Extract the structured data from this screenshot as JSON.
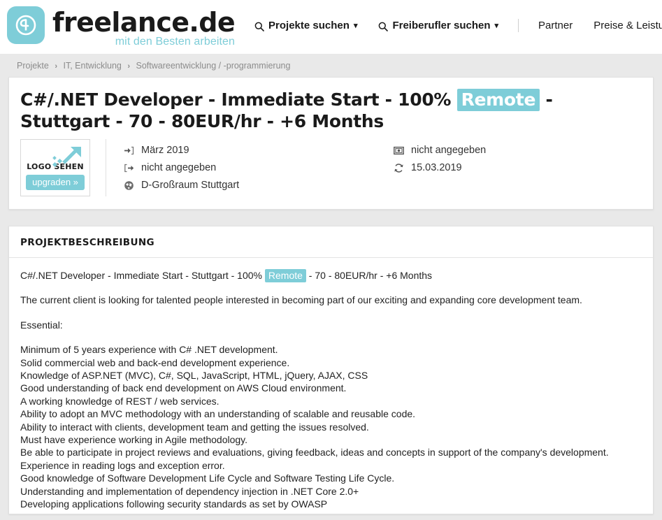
{
  "brand": {
    "name": "freelance.de",
    "tagline": "mit den Besten arbeiten",
    "logo_color": "#7ecdd8"
  },
  "nav": {
    "items": [
      {
        "label": "Projekte suchen",
        "icon": "search-icon",
        "caret": "⌄",
        "bold": true
      },
      {
        "label": "Freiberufler suchen",
        "icon": "search-icon",
        "caret": "⌄",
        "bold": true
      },
      {
        "label": "Partner",
        "icon": "",
        "caret": "",
        "bold": false
      },
      {
        "label": "Preise & Leistungen",
        "icon": "",
        "caret": "⌄",
        "bold": false
      }
    ]
  },
  "breadcrumb": {
    "separator": "›",
    "items": [
      "Projekte",
      "IT, Entwicklung",
      "Softwareentwicklung / -programmierung"
    ]
  },
  "project": {
    "title_part1": "C#/.NET Developer - Immediate Start - 100% ",
    "title_highlight": "Remote",
    "title_part2": " - Stuttgart - 70 - 80EUR/hr - +6 Months",
    "highlight_color": "#7ecdd8"
  },
  "logo_box": {
    "label": "LOGO SEHEN",
    "badge": "upgraden »",
    "badge_color": "#7ecdd8"
  },
  "meta": {
    "left": [
      {
        "icon": "arrow-into-bracket-icon",
        "value": "März 2019"
      },
      {
        "icon": "arrow-out-of-bracket-icon",
        "value": "nicht angegeben"
      },
      {
        "icon": "globe-icon",
        "value": "D-Großraum Stuttgart"
      }
    ],
    "right": [
      {
        "icon": "banknote-icon",
        "value": "nicht angegeben"
      },
      {
        "icon": "refresh-icon",
        "value": "15.03.2019"
      }
    ]
  },
  "description": {
    "heading": "PROJEKTBESCHREIBUNG",
    "headline_part1": "C#/.NET Developer - Immediate Start - Stuttgart - 100% ",
    "headline_highlight": "Remote",
    "headline_part2": " - 70 - 80EUR/hr - +6 Months",
    "intro": "The current client is looking for talented people interested in becoming part of our exciting and expanding core development team.",
    "section_label": "Essential:",
    "requirements": "Minimum of 5 years experience with C# .NET development.\nSolid commercial web and back-end development experience.\nKnowledge of ASP.NET (MVC), C#, SQL, JavaScript, HTML, jQuery, AJAX, CSS\nGood understanding of back end development on AWS Cloud environment.\nA working knowledge of REST / web services.\nAbility to adopt an MVC methodology with an understanding of scalable and reusable code.\nAbility to interact with clients, development team and getting the issues resolved.\nMust have experience working in Agile methodology.\nBe able to participate in project reviews and evaluations, giving feedback, ideas and concepts in support of the company's development.\nExperience in reading logs and exception error.\nGood knowledge of Software Development Life Cycle and Software Testing Life Cycle.\nUnderstanding and implementation of dependency injection in .NET Core 2.0+\nDeveloping applications following security standards as set by OWASP"
  }
}
